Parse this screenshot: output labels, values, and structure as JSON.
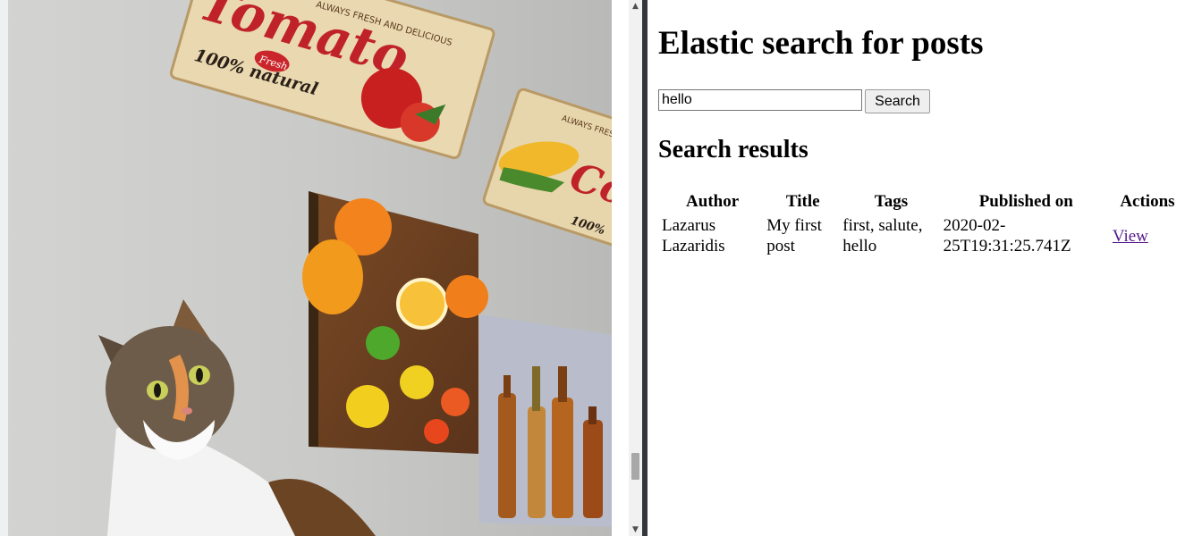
{
  "photo": {
    "alt": "photo",
    "signs": {
      "tomato_word": "Tomato",
      "tomato_arc": "ALWAYS FRESH AND DELICIOUS",
      "tomato_badge": "Fresh",
      "tomato_natural": "100% natural",
      "corn_word": "Co",
      "corn_arc": "ALWAYS FRESH AND",
      "corn_natural": "100%"
    }
  },
  "search": {
    "title": "Elastic search for posts",
    "query": "hello",
    "button_label": "Search"
  },
  "results": {
    "heading": "Search results",
    "columns": [
      "Author",
      "Title",
      "Tags",
      "Published on",
      "Actions"
    ],
    "rows": [
      {
        "author": "Lazarus Lazaridis",
        "title": "My first post",
        "tags": "first, salute, hello",
        "published_on": "2020-02-25T19:31:25.741Z",
        "action": "View"
      }
    ]
  },
  "scrollbar": {
    "up_arrow": "▲",
    "down_arrow": "▼"
  },
  "colors": {
    "link": "#551a8b",
    "divider": "#33363b"
  }
}
